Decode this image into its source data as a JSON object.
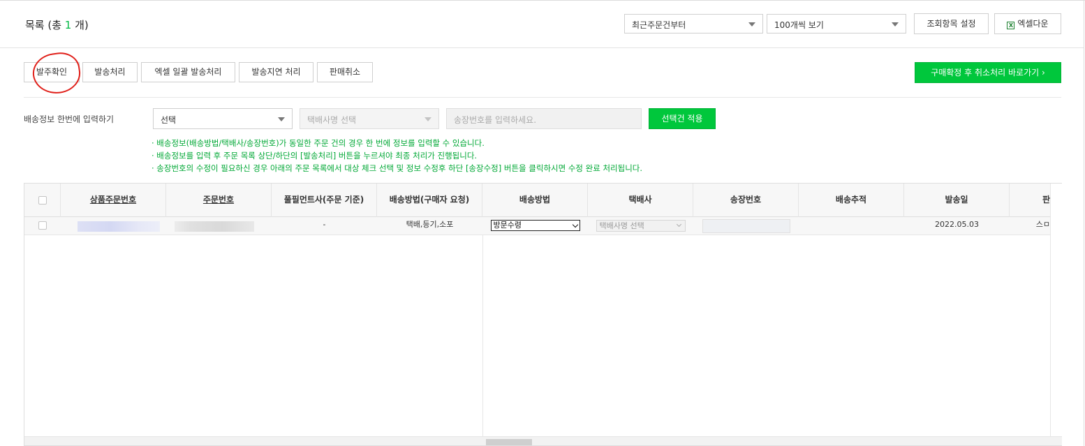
{
  "header": {
    "title_prefix": "목록 (총 ",
    "title_count": "1",
    "title_suffix": " 개)",
    "sort_select": "최근주문건부터",
    "page_size_select": "100개씩 보기",
    "column_settings_button": "조회항목 설정",
    "excel_download_button": "엑셀다운",
    "excel_icon_glyph": "X"
  },
  "actions": {
    "order_confirm": "발주확인",
    "ship": "발송처리",
    "excel_bulk_ship": "엑셀 일괄 발송처리",
    "ship_delay": "발송지연 처리",
    "cancel_sale": "판매취소",
    "go_cancel_after_confirm": "구매확정 후 취소처리 바로가기",
    "go_arrow": "›"
  },
  "bulk_input": {
    "label": "배송정보 한번에 입력하기",
    "method_select": "선택",
    "courier_select": "택배사명 선택",
    "tracking_placeholder": "송장번호를 입력하세요.",
    "apply_button": "선택건 적용"
  },
  "notes": [
    "· 배송정보(배송방법/택배사/송장번호)가 동일한 주문 건의 경우 한 번에 정보를 입력할 수 있습니다.",
    "· 배송정보를 입력 후 주문 목록 상단/하단의 [발송처리] 버튼을 누르셔야 최종 처리가 진행됩니다.",
    "· 송장번호의 수정이 필요하신 경우 아래의 주문 목록에서 대상 체크 선택 및 정보 수정후 하단 [송장수정] 버튼을 클릭하시면 수정 완료 처리됩니다."
  ],
  "table": {
    "columns": [
      "상품주문번호",
      "주문번호",
      "풀필먼트사(주문 기준)",
      "배송방법(구매자 요청)",
      "배송방법",
      "택배사",
      "송장번호",
      "배송추적",
      "발송일",
      "판"
    ],
    "row": {
      "fulfillment": "-",
      "requested_method": "택배,등기,소포",
      "method_select": "방문수령",
      "courier_select": "택배사명 선택",
      "tracking_number": "",
      "ship_date": "2022.05.03",
      "last_cell": "스ㅁ"
    }
  },
  "colors": {
    "accent_green": "#00c73c",
    "note_green": "#00a835",
    "annotation_red": "#e0201a"
  }
}
